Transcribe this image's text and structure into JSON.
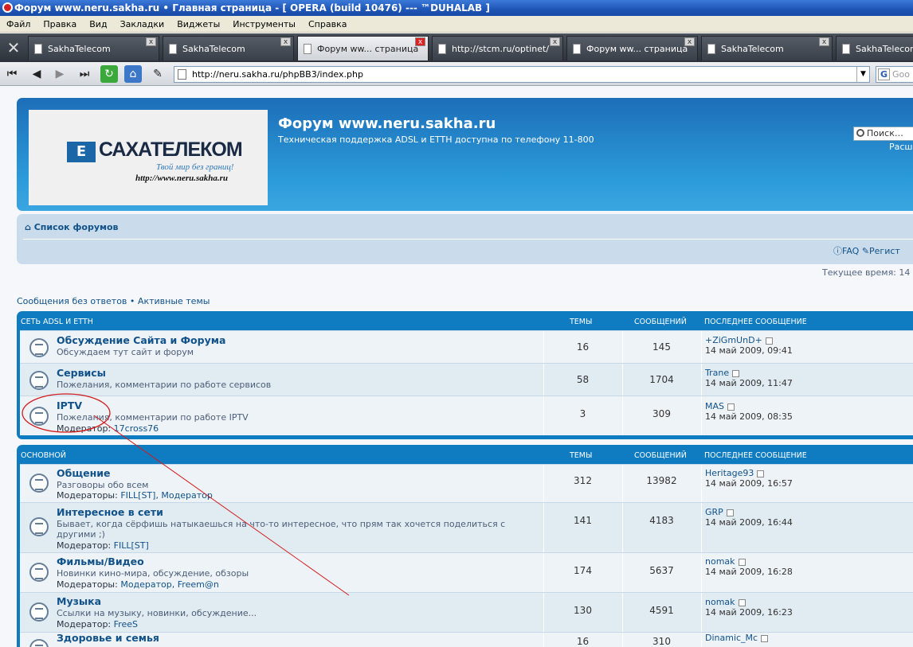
{
  "window": {
    "title": "Форум www.neru.sakha.ru • Главная страница - [ OPERA (build 10476) --- ™DUHALAB ]"
  },
  "menu": [
    "Файл",
    "Правка",
    "Вид",
    "Закладки",
    "Виджеты",
    "Инструменты",
    "Справка"
  ],
  "tabs": [
    {
      "label": "SakhaTelecom",
      "active": false
    },
    {
      "label": "SakhaTelecom",
      "active": false
    },
    {
      "label": "Форум ww... страница",
      "active": true
    },
    {
      "label": "http://stcm.ru/optinet/",
      "active": false
    },
    {
      "label": "Форум ww... страница",
      "active": false
    },
    {
      "label": "SakhaTelecom",
      "active": false
    },
    {
      "label": "SakhaTelecom",
      "active": false
    }
  ],
  "address": {
    "url": "http://neru.sakha.ru/phpBB3/index.php",
    "search_placeholder": "Goo"
  },
  "header": {
    "logo_name": "САХАТЕЛЕКОМ",
    "logo_slogan": "Твой мир без границ!",
    "logo_url": "http://www.neru.sakha.ru",
    "site_title": "Форум www.neru.sakha.ru",
    "site_desc": "Техническая поддержка ADSL и ETTH доступна по телефону 11-800",
    "search_placeholder": "Поиск…",
    "advanced": "Расш"
  },
  "nav": {
    "breadcrumb": "Список форумов",
    "faq": "FAQ",
    "register": "Регист"
  },
  "current_time": "Текущее время: 14",
  "quicklinks": {
    "unanswered": "Сообщения без ответов",
    "sep": "•",
    "active": "Активные темы"
  },
  "columns": {
    "topics": "Темы",
    "posts": "Сообщений",
    "last": "Последнее сообщение"
  },
  "categories": [
    {
      "name": "Сеть ADSL и ETTH",
      "forums": [
        {
          "title": "Обсуждение Сайта и Форума",
          "desc": "Обсуждаем тут сайт и форум",
          "mod_label": "",
          "mods": "",
          "topics": "16",
          "posts": "145",
          "last_user": "+ZiGmUnD+",
          "last_date": "14 май 2009, 09:41"
        },
        {
          "title": "Сервисы",
          "desc": "Пожелания, комментарии по работе сервисов",
          "mod_label": "",
          "mods": "",
          "topics": "58",
          "posts": "1704",
          "last_user": "Trane",
          "last_date": "14 май 2009, 11:47"
        },
        {
          "title": "IPTV",
          "desc": "Пожелания, комментарии по работе IPTV",
          "mod_label": "Модератор:",
          "mods": "17cross76",
          "topics": "3",
          "posts": "309",
          "last_user": "MAS",
          "last_date": "14 май 2009, 08:35"
        }
      ]
    },
    {
      "name": "Основной",
      "forums": [
        {
          "title": "Общение",
          "desc": "Разговоры обо всем",
          "mod_label": "Модераторы:",
          "mods": "FILL[ST], Модератор",
          "topics": "312",
          "posts": "13982",
          "last_user": "Heritage93",
          "last_date": "14 май 2009, 16:57"
        },
        {
          "title": "Интересное в сети",
          "desc": "Бывает, когда сёрфишь натыкаешься на что-то интересное, что прям так хочется поделиться с другими ;)",
          "mod_label": "Модератор:",
          "mods": "FILL[ST]",
          "topics": "141",
          "posts": "4183",
          "last_user": "GRP",
          "last_date": "14 май 2009, 16:44"
        },
        {
          "title": "Фильмы/Видео",
          "desc": "Новинки кино-мира, обсуждение, обзоры",
          "mod_label": "Модераторы:",
          "mods": "Модератор, Freem@n",
          "topics": "174",
          "posts": "5637",
          "last_user": "nomak",
          "last_date": "14 май 2009, 16:28"
        },
        {
          "title": "Музыка",
          "desc": "Ссылки на музыку, новинки, обсуждение...",
          "mod_label": "Модератор:",
          "mods": "FreeS",
          "topics": "130",
          "posts": "4591",
          "last_user": "nomak",
          "last_date": "14 май 2009, 16:23"
        },
        {
          "title": "Здоровье и семья",
          "desc": "",
          "mod_label": "",
          "mods": "",
          "topics": "16",
          "posts": "310",
          "last_user": "Dinamic_Mc",
          "last_date": ""
        }
      ]
    }
  ]
}
